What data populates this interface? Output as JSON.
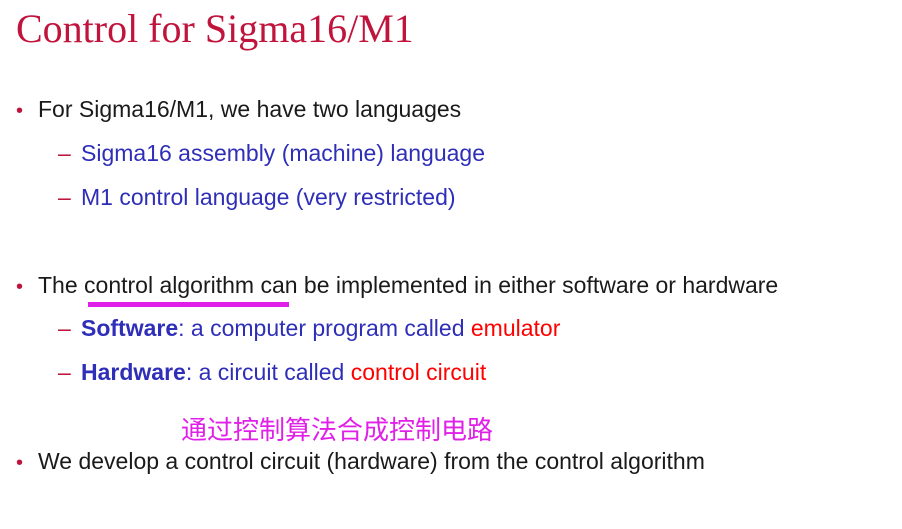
{
  "title": "Control for Sigma16/M1",
  "bullets": {
    "languages": {
      "text": "For Sigma16/M1, we have two languages",
      "items": [
        "Sigma16 assembly (machine) language",
        "M1 control language (very restricted)"
      ]
    },
    "algorithm": {
      "prefix": "The ",
      "highlight": "control algorithm",
      "suffix": " can be implemented in either software or hardware",
      "software": {
        "term": "Software",
        "middle": ": a computer program called ",
        "value": "emulator"
      },
      "hardware": {
        "term": "Hardware",
        "middle": ": a circuit called ",
        "value": "control circuit"
      }
    },
    "develop": {
      "text": "We develop a control circuit (hardware) from the control algorithm"
    }
  },
  "annotation": {
    "note": "通过控制算法合成控制电路",
    "color": "#e020e8"
  },
  "colors": {
    "title": "#c0143c",
    "bullet_marker": "#c0143c",
    "sub_text": "#2e2eb8",
    "emphasis": "#ff0000",
    "body_text": "#1a1a1a"
  },
  "icons": {
    "bullet": "•",
    "dash": "–"
  }
}
